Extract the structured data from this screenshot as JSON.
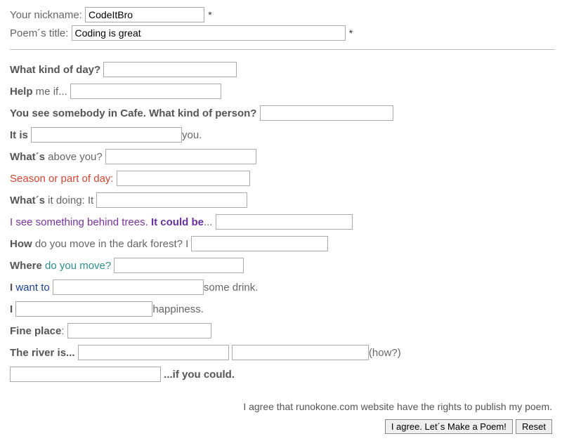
{
  "top": {
    "nick_label": "Your nickname:",
    "nick_value": "CodeItBro",
    "title_label": "Poem´s title:",
    "title_value": "Coding is great",
    "star": "*"
  },
  "lines": {
    "l1_a": "What kind of day?",
    "l2_a": "Help",
    "l2_b": " me if...",
    "l3_a": "You see somebody in Cafe. What kind of person?",
    "l4_a": "It is",
    "l4_b": "you.",
    "l5_a": "What´s",
    "l5_b": " above you?",
    "l6_a": "Season or part of day:",
    "l7_a": "What´s",
    "l7_b": " it doing: It",
    "l8_a": "I see something behind trees.",
    "l8_b": " It could be",
    "l8_c": "...",
    "l9_a": "How",
    "l9_b": " do you move in the dark forest? I",
    "l10_a": "Where",
    "l10_b": " do you move?",
    "l11_a": "I",
    "l11_b": " want to ",
    "l11_c": "some drink.",
    "l12_a": "I",
    "l12_b": "happiness.",
    "l13_a": "Fine place",
    "l13_b": ":",
    "l14_a": "The river is...",
    "l14_b": "(how?)",
    "l15_a": "...if you could."
  },
  "footer": {
    "agree": "I  agree that runokone.com website have the rights to publish my poem.",
    "submit": "I agree. Let´s Make a Poem!",
    "reset": "Reset"
  }
}
